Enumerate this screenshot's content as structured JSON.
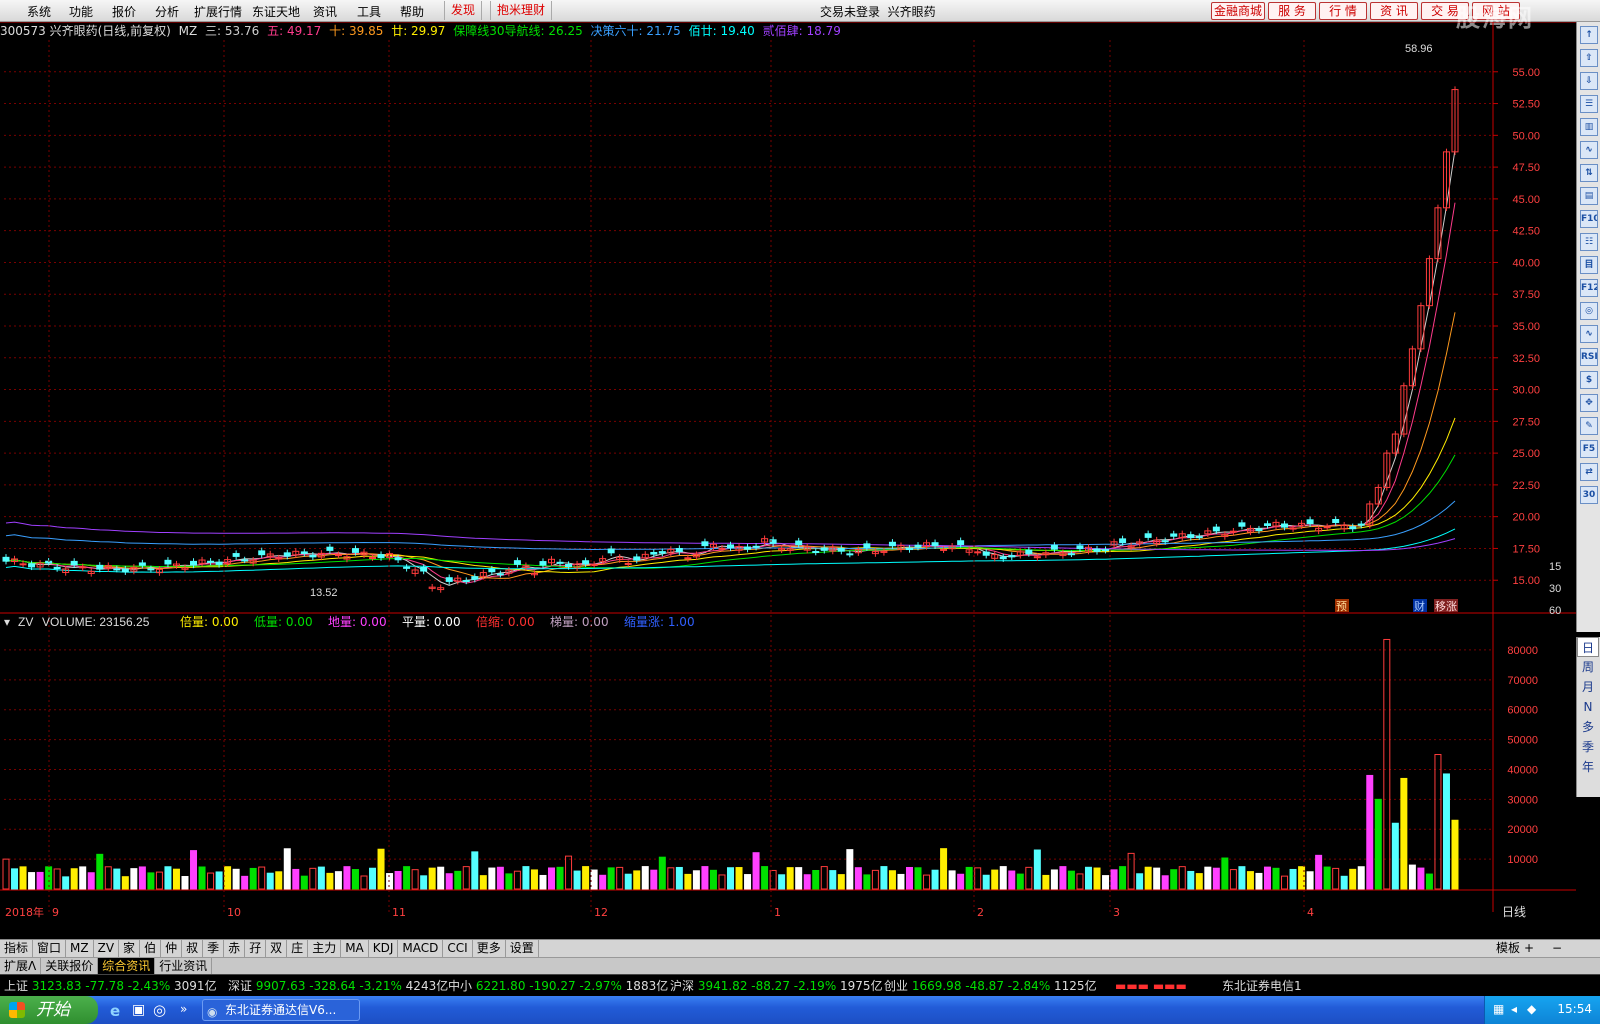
{
  "menu": {
    "items": [
      "系统",
      "功能",
      "报价",
      "分析",
      "扩展行情",
      "东证天地",
      "资讯",
      "工具",
      "帮助"
    ],
    "discover": "发现",
    "finance": "抱米理财",
    "status": "交易未登录",
    "stock_name_title": "兴齐眼药",
    "right_buttons": [
      "金融商城",
      "服 务",
      "行 情",
      "资 讯",
      "交 易",
      "网 站"
    ]
  },
  "watermark": "股海网",
  "stock": {
    "code_title": "300573 兴齐眼药(日线,前复权)",
    "indicator": "MZ",
    "lines": [
      {
        "label": "三: 53.76",
        "color": "#cfcfcf"
      },
      {
        "label": "五: 49.17",
        "color": "#ff3c8c"
      },
      {
        "label": "十: 39.85",
        "color": "#ff9a1e"
      },
      {
        "label": "廿: 29.97",
        "color": "#ffee00"
      },
      {
        "label": "保障线30导航线: 26.25",
        "color": "#00e000"
      },
      {
        "label": "决策六十: 21.75",
        "color": "#3aa0ff"
      },
      {
        "label": "佰廿: 19.40",
        "color": "#00ffff"
      },
      {
        "label": "贰佰肆: 18.79",
        "color": "#a040ff"
      }
    ]
  },
  "colors": {
    "up": "#ff3c3c",
    "down": "#54ffff",
    "grid": "#7a0000",
    "axis": "#c80000"
  },
  "price_axis": {
    "labels": [
      "55.00",
      "52.50",
      "50.00",
      "47.50",
      "45.00",
      "42.50",
      "40.00",
      "37.50",
      "35.00",
      "32.50",
      "30.00",
      "27.50",
      "25.00",
      "22.50",
      "20.00",
      "17.50",
      "15.00"
    ],
    "right_nums": [
      "15",
      "30",
      "60"
    ]
  },
  "annotations": {
    "high": "58.96",
    "low": "13.52",
    "marker_pre": "预",
    "marker_cai": "财",
    "marker_move": "移涨"
  },
  "volume": {
    "title": "ZV",
    "label": "VOLUME: 23156.25",
    "stats": [
      {
        "label": "倍量: 0.00",
        "color": "#ffee00"
      },
      {
        "label": "低量: 0.00",
        "color": "#00e000"
      },
      {
        "label": "地量: 0.00",
        "color": "#ff40ff"
      },
      {
        "label": "平量: 0.00",
        "color": "#ffffff"
      },
      {
        "label": "倍缩: 0.00",
        "color": "#ff3030"
      },
      {
        "label": "梯量: 0.00",
        "color": "#c0a0c0"
      },
      {
        "label": "缩量涨: 1.00",
        "color": "#3060ff"
      }
    ],
    "axis": [
      "80000",
      "70000",
      "60000",
      "50000",
      "40000",
      "30000",
      "20000",
      "10000"
    ]
  },
  "date_axis": {
    "labels": [
      "2018年",
      "9",
      "10",
      "11",
      "12",
      "1",
      "2",
      "3",
      "4"
    ],
    "period": "日线"
  },
  "period_tools": [
    "日",
    "周",
    "月",
    "N",
    "多",
    "季",
    "年"
  ],
  "side_tools": [
    "↑",
    "⇧",
    "⇩",
    "☰",
    "▥",
    "∿",
    "⇅",
    "▤",
    "F10",
    "☷",
    "目",
    "F12",
    "◎",
    "∿",
    "RSI",
    "$",
    "✥",
    "✎",
    "F5",
    "⇄",
    "30"
  ],
  "chart_data": {
    "type": "candlestick",
    "price_range": [
      12.5,
      57.5
    ],
    "volume_range": [
      0,
      86000
    ],
    "x_labels": [
      "9",
      "10",
      "11",
      "12",
      "1",
      "2",
      "3",
      "4"
    ],
    "high": 58.96,
    "low": 13.52,
    "latest_volume": 23156.25
  },
  "tabs": [
    "指标",
    "窗口",
    "MZ",
    "ZV",
    "家",
    "伯",
    "仲",
    "叔",
    "季",
    "赤",
    "孖",
    "双",
    "庄",
    "主力",
    "MA",
    "KDJ",
    "MACD",
    "CCI",
    "更多",
    "设置"
  ],
  "tabs_right": [
    "模板",
    "+",
    "−"
  ],
  "tabs2": [
    "扩展Λ",
    "关联报价",
    "综合资讯",
    "行业资讯"
  ],
  "quotes": [
    {
      "name": "上证",
      "price": "3123.83",
      "chg": "-77.78",
      "pct": "-2.43%",
      "amt": "3091亿"
    },
    {
      "name": "深证",
      "price": "9907.63",
      "chg": "-328.64",
      "pct": "-3.21%",
      "amt": "4243亿"
    },
    {
      "name": "中小",
      "price": "6221.80",
      "chg": "-190.27",
      "pct": "-2.97%",
      "amt": "1883亿"
    },
    {
      "name": "沪深",
      "price": "3941.82",
      "chg": "-88.27",
      "pct": "-2.19%",
      "amt": "1975亿"
    },
    {
      "name": "创业",
      "price": "1669.98",
      "chg": "-48.87",
      "pct": "-2.84%",
      "amt": "1125亿"
    }
  ],
  "server": "东北证券电信1",
  "taskbar": {
    "start": "开始",
    "item": "东北证券通达信V6...",
    "clock": "15:54"
  }
}
